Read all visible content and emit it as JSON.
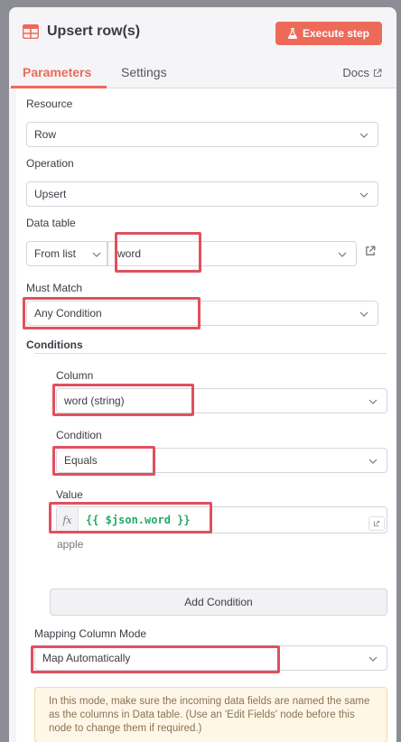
{
  "node": {
    "title": "Upsert row(s)",
    "icon": "table-icon"
  },
  "toolbar": {
    "execute_label": "Execute step"
  },
  "tabs": [
    {
      "label": "Parameters"
    },
    {
      "label": "Settings"
    }
  ],
  "docs": {
    "label": "Docs"
  },
  "resource": {
    "label": "Resource",
    "value": "Row"
  },
  "operation": {
    "label": "Operation",
    "value": "Upsert"
  },
  "data_table": {
    "label": "Data table",
    "mode": "From list",
    "value": "word"
  },
  "must_match": {
    "label": "Must Match",
    "value": "Any Condition"
  },
  "conditions": {
    "label": "Conditions",
    "column": {
      "label": "Column",
      "value": "word (string)"
    },
    "condition": {
      "label": "Condition",
      "value": "Equals"
    },
    "value": {
      "label": "Value",
      "expression": "{{ $json.word }}",
      "preview": "apple"
    },
    "add_label": "Add Condition"
  },
  "mapping": {
    "label": "Mapping Column Mode",
    "value": "Map Automatically"
  },
  "notice": {
    "text": "In this mode, make sure the incoming data fields are named the same as the columns in Data table. (Use an 'Edit Fields' node before this node to change them if required.)"
  },
  "colors": {
    "accent": "#ED6A5A",
    "highlight": "#E0505F",
    "expression_green": "#27A865",
    "notice_bg": "#FEF7E8"
  }
}
